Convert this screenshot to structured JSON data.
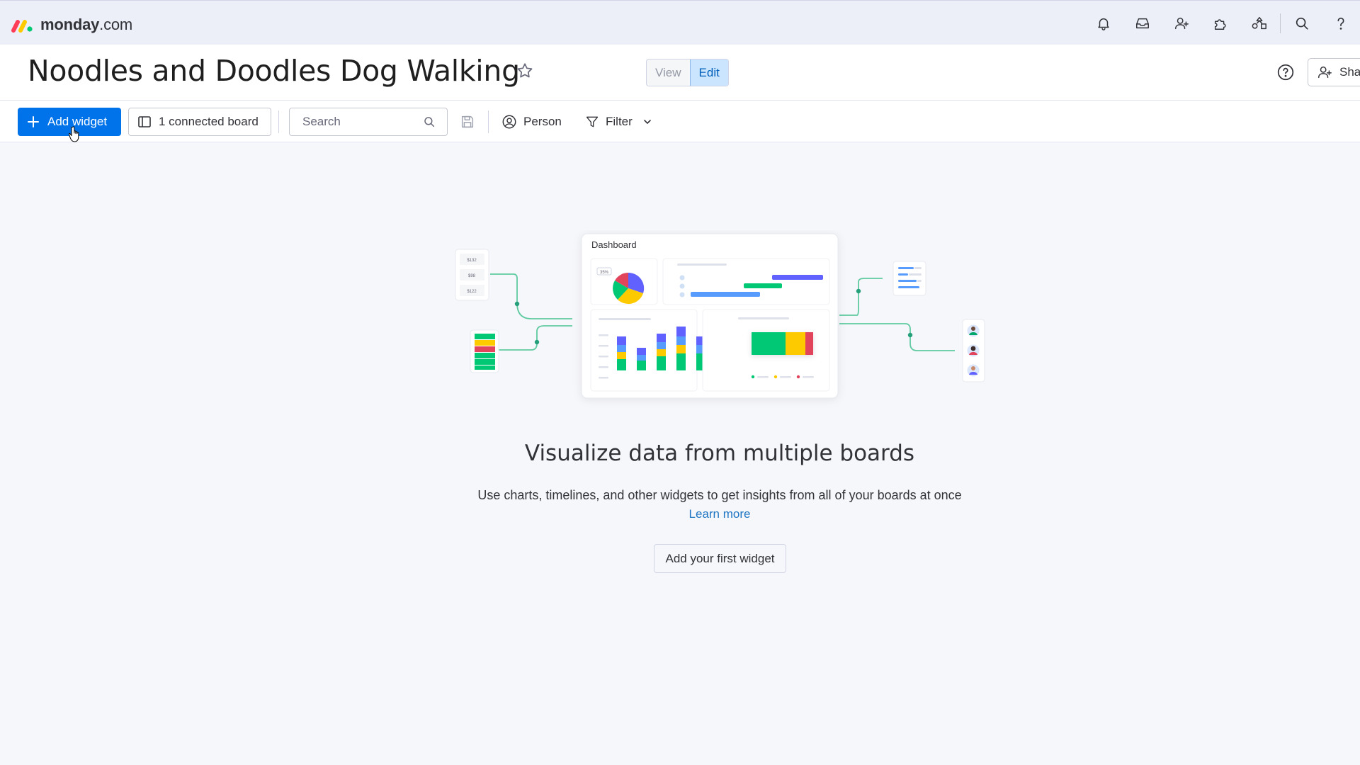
{
  "app": {
    "brand_bold": "monday",
    "brand_suffix": ".com",
    "top_icons": [
      "bell-icon",
      "inbox-icon",
      "invite-members-icon",
      "apps-icon",
      "templates-icon",
      "search-icon",
      "help-icon"
    ]
  },
  "header": {
    "title": "Noodles and Doodles Dog Walking",
    "view_label": "View",
    "edit_label": "Edit",
    "active_mode": "Edit",
    "share_label": "Sha"
  },
  "toolbar": {
    "add_widget_label": "Add widget",
    "connected_boards_label": "1 connected board",
    "search_placeholder": "Search",
    "person_label": "Person",
    "filter_label": "Filter"
  },
  "illustration": {
    "card_title": "Dashboard",
    "pie_percent": "35%",
    "price_values": [
      "$132",
      "$98",
      "$122"
    ]
  },
  "empty_state": {
    "title": "Visualize data from multiple boards",
    "subtitle": "Use charts, timelines, and other widgets to get insights from all of your boards at once",
    "learn_more": "Learn more",
    "cta_label": "Add your first widget"
  },
  "colors": {
    "primary": "#0073ea",
    "green": "#00c875",
    "yellow": "#fdca00",
    "red": "#e2445c",
    "purple": "#6161ff",
    "blue": "#579bfc"
  }
}
